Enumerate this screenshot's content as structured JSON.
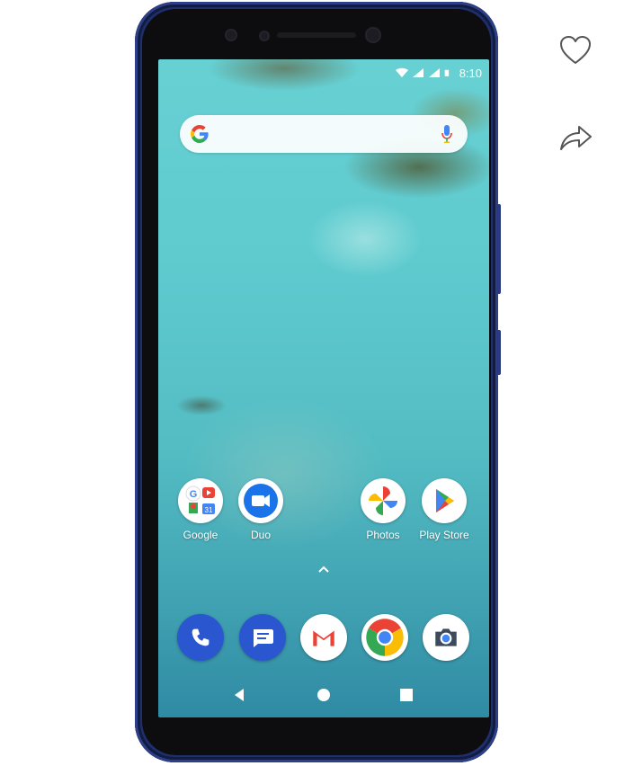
{
  "status_bar": {
    "time": "8:10"
  },
  "home_apps": [
    {
      "label": "Google"
    },
    {
      "label": "Duo"
    },
    {
      "label": "Photos"
    },
    {
      "label": "Play Store"
    }
  ],
  "colors": {
    "phone_body": "#1e2f6b",
    "google_blue": "#4285f4",
    "google_red": "#ea4335",
    "google_yellow": "#fbbc05",
    "google_green": "#34a853",
    "dock_blue": "#2a56d0"
  },
  "icons": {
    "side": [
      "heart-icon",
      "share-icon"
    ],
    "dock": [
      "phone-icon",
      "messages-icon",
      "gmail-icon",
      "chrome-icon",
      "camera-icon"
    ],
    "nav": [
      "back-icon",
      "home-icon",
      "recents-icon"
    ]
  }
}
